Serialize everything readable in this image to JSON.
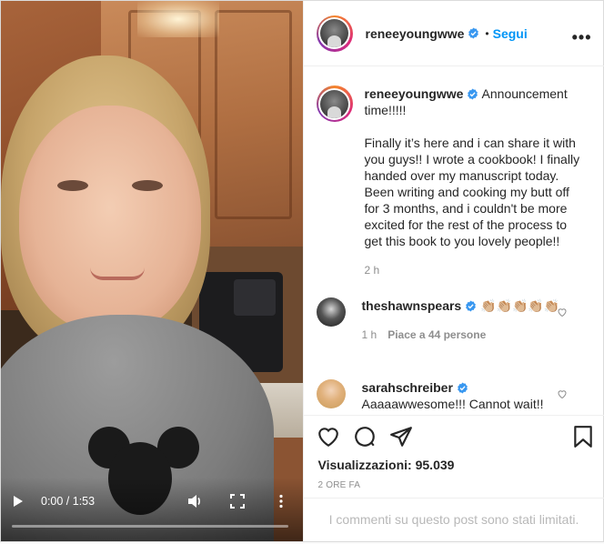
{
  "video": {
    "time": "0:00 / 1:53",
    "progress": 0
  },
  "header": {
    "username": "reneeyoungwwe",
    "separator": "•",
    "follow_label": "Segui",
    "more_label": "•••"
  },
  "caption": {
    "username": "reneeyoungwwe",
    "title": "Announcement time!!!!!",
    "body": "Finally it’s here and i can share it with you guys!! I wrote a cookbook! I finally handed over my manuscript today. Been writing and cooking my butt off for 3 months, and i couldn't be more excited for the rest of the process to get this book to you lovely people!!",
    "time": "2 h"
  },
  "comments": [
    {
      "username": "theshawnspears",
      "text": "👏🏼👏🏼👏🏼👏🏼👏🏼",
      "time": "1 h",
      "likes": "Piace a 44 persone"
    },
    {
      "username": "sarahschreiber",
      "text": "Aaaaawwesome!!! Cannot wait!!",
      "time": "",
      "likes": ""
    }
  ],
  "actions": {
    "views_label": "Visualizzazioni:",
    "views_count": "95.039",
    "date": "2 ORE FA",
    "limited_msg": "I commenti su questo post sono stati limitati."
  },
  "colors": {
    "link": "#0095f6",
    "verified": "#3897f0",
    "muted": "#8e8e8e"
  }
}
